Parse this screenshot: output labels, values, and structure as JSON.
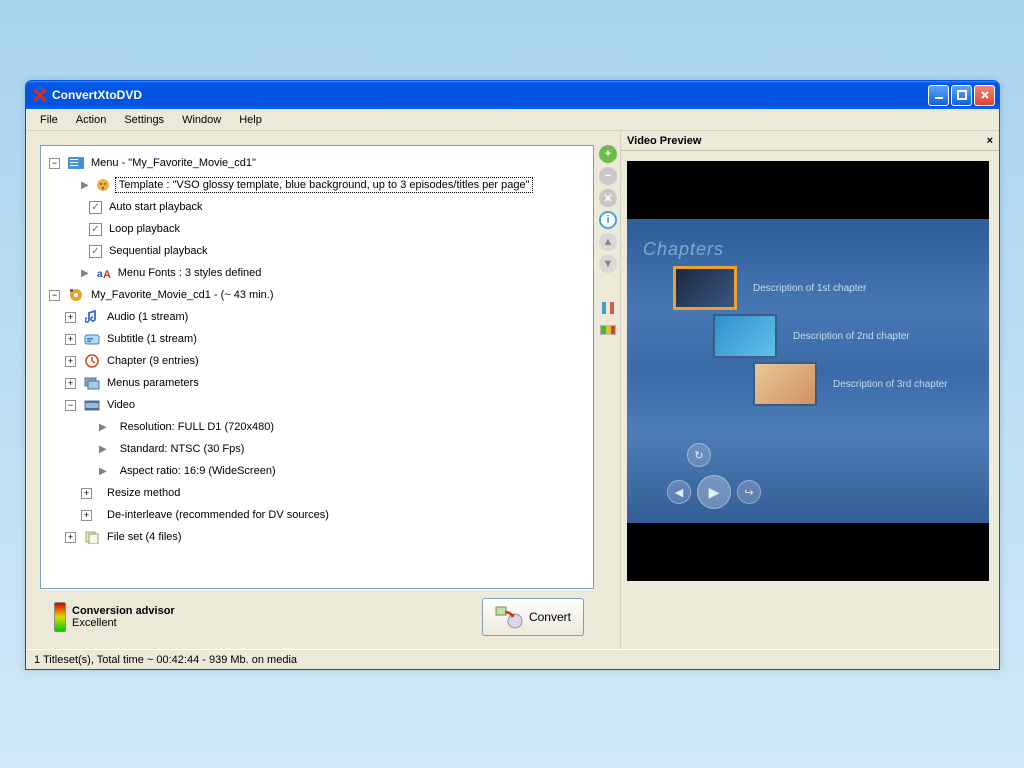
{
  "app": {
    "title": "ConvertXtoDVD"
  },
  "menubar": {
    "file": "File",
    "action": "Action",
    "settings": "Settings",
    "window": "Window",
    "help": "Help"
  },
  "tree": {
    "menu_root": "Menu - \"My_Favorite_Movie_cd1\"",
    "template": "Template : \"VSO glossy template, blue background, up to 3 episodes/titles per page\"",
    "auto_start": "Auto start playback",
    "loop": "Loop playback",
    "sequential": "Sequential playback",
    "menu_fonts": "Menu Fonts : 3 styles defined",
    "movie_root": "My_Favorite_Movie_cd1 - (~ 43 min.)",
    "audio": "Audio (1 stream)",
    "subtitle": "Subtitle (1 stream)",
    "chapter": "Chapter (9 entries)",
    "menus_params": "Menus parameters",
    "video": "Video",
    "resolution": "Resolution: FULL D1 (720x480)",
    "standard": "Standard: NTSC (30 Fps)",
    "aspect": "Aspect ratio: 16:9 (WideScreen)",
    "resize": "Resize method",
    "deinterleave": "De-interleave (recommended for DV sources)",
    "fileset": "File set (4 files)"
  },
  "preview": {
    "title": "Video Preview",
    "heading": "Chapters",
    "ch1": "Description of 1st chapter",
    "ch2": "Description of 2nd chapter",
    "ch3": "Description of 3rd chapter"
  },
  "advisor": {
    "title": "Conversion advisor",
    "status": "Excellent"
  },
  "convert": {
    "label": "Convert"
  },
  "status": {
    "text": "1 Titleset(s), Total time ~ 00:42:44 - 939 Mb. on media"
  }
}
